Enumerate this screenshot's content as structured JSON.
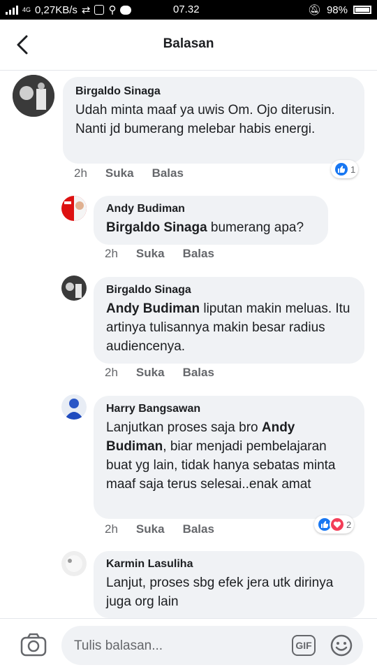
{
  "status_bar": {
    "network": "4G",
    "speed": "0,27KB/s",
    "time": "07.32",
    "battery": "98%"
  },
  "header": {
    "title": "Balasan",
    "back_icon": "chevron-left-icon"
  },
  "comments": [
    {
      "author": "Birgaldo Sinaga",
      "mention": "",
      "text": "Udah minta maaf ya uwis Om. Ojo diterusin. Nanti jd bumerang melebar habis energi.",
      "time": "2h",
      "like": "Suka",
      "reply": "Balas",
      "reaction_count": "1"
    },
    {
      "author": "Andy Budiman",
      "mention": "Birgaldo Sinaga",
      "text": " bumerang apa?",
      "time": "2h",
      "like": "Suka",
      "reply": "Balas"
    },
    {
      "author": "Birgaldo Sinaga",
      "mention": "Andy Budiman",
      "text": " liputan makin meluas. Itu artinya tulisannya makin besar radius audiencenya.",
      "time": "2h",
      "like": "Suka",
      "reply": "Balas"
    },
    {
      "author": "Harry Bangsawan",
      "text_before": "Lanjutkan proses saja bro ",
      "mention": "Andy Budiman",
      "text": ", biar menjadi pembelajaran buat yg lain, tidak hanya sebatas minta maaf saja terus selesai..enak amat",
      "time": "2h",
      "like": "Suka",
      "reply": "Balas",
      "reaction_count": "2"
    },
    {
      "author": "Karmin Lasuliha",
      "mention": "",
      "text": "Lanjut, proses sbg efek jera utk dirinya juga org lain"
    }
  ],
  "composer": {
    "placeholder": "Tulis balasan...",
    "gif_label": "GIF"
  },
  "colors": {
    "accent": "#1877f2",
    "love": "#f33e58",
    "bubble": "#f0f2f5",
    "secondary_text": "#65676b"
  }
}
